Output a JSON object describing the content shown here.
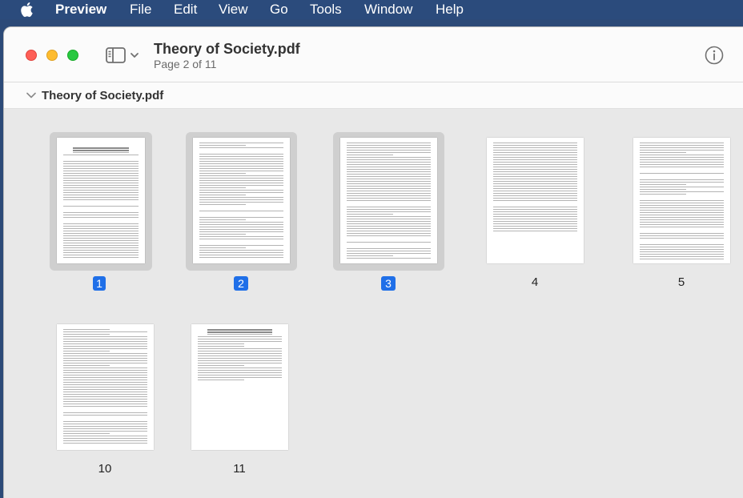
{
  "menu": {
    "app": "Preview",
    "items": [
      "File",
      "Edit",
      "View",
      "Go",
      "Tools",
      "Window",
      "Help"
    ]
  },
  "window": {
    "title": "Theory of Society.pdf",
    "subtitle": "Page 2 of 11",
    "section_title": "Theory of Society.pdf"
  },
  "pages": [
    {
      "label": "1",
      "selected": true
    },
    {
      "label": "2",
      "selected": true
    },
    {
      "label": "3",
      "selected": true
    },
    {
      "label": "4",
      "selected": false
    },
    {
      "label": "5",
      "selected": false
    },
    {
      "label": "10",
      "selected": false
    },
    {
      "label": "11",
      "selected": false
    }
  ],
  "colors": {
    "selection_badge": "#1f6fe8",
    "close": "#fe5f57",
    "minimize": "#febc2e",
    "zoom": "#28c840",
    "menubar": "#2b4b7c"
  },
  "icons": {
    "apple": "apple-icon",
    "sidebar": "sidebar-toggle-icon",
    "info": "info-icon",
    "disclosure": "chevron-down-icon"
  }
}
